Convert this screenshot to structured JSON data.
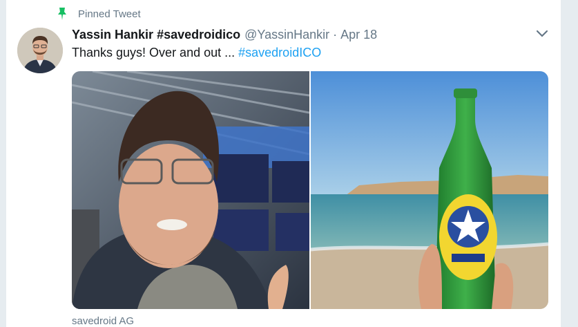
{
  "pinned": {
    "label": "Pinned Tweet",
    "icon": "pin-icon",
    "color": "#17bf63"
  },
  "tweet": {
    "author_name": "Yassin Hankir #savedroidico",
    "handle": "@YassinHankir",
    "separator": "·",
    "date": "Apr 18",
    "text": "Thanks guys! Over and out ...",
    "hashtag": "#savedroidICO",
    "menu_icon": "chevron-down-icon"
  },
  "media": {
    "photos": [
      {
        "name": "selfie-airport-photo"
      },
      {
        "name": "beer-beach-photo"
      }
    ]
  },
  "quoted_account": "savedroid AG",
  "colors": {
    "link": "#1da1f2",
    "muted": "#657786",
    "text": "#14171a"
  }
}
